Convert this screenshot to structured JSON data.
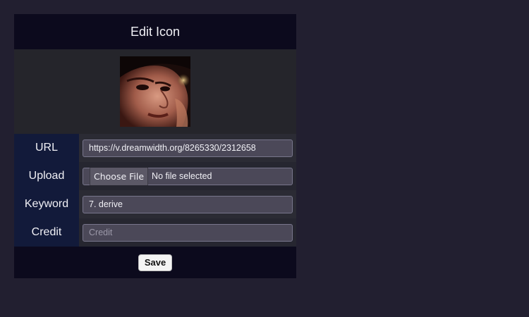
{
  "header": {
    "title": "Edit Icon"
  },
  "preview": {
    "image": "icon-preview-portrait"
  },
  "form": {
    "url": {
      "label": "URL",
      "value": "https://v.dreamwidth.org/8265330/2312658"
    },
    "upload": {
      "label": "Upload",
      "button_label": "Choose File",
      "status": "No file selected"
    },
    "keyword": {
      "label": "Keyword",
      "value": "7. derive"
    },
    "credit": {
      "label": "Credit",
      "value": "",
      "placeholder": "Credit"
    }
  },
  "footer": {
    "save_label": "Save"
  }
}
